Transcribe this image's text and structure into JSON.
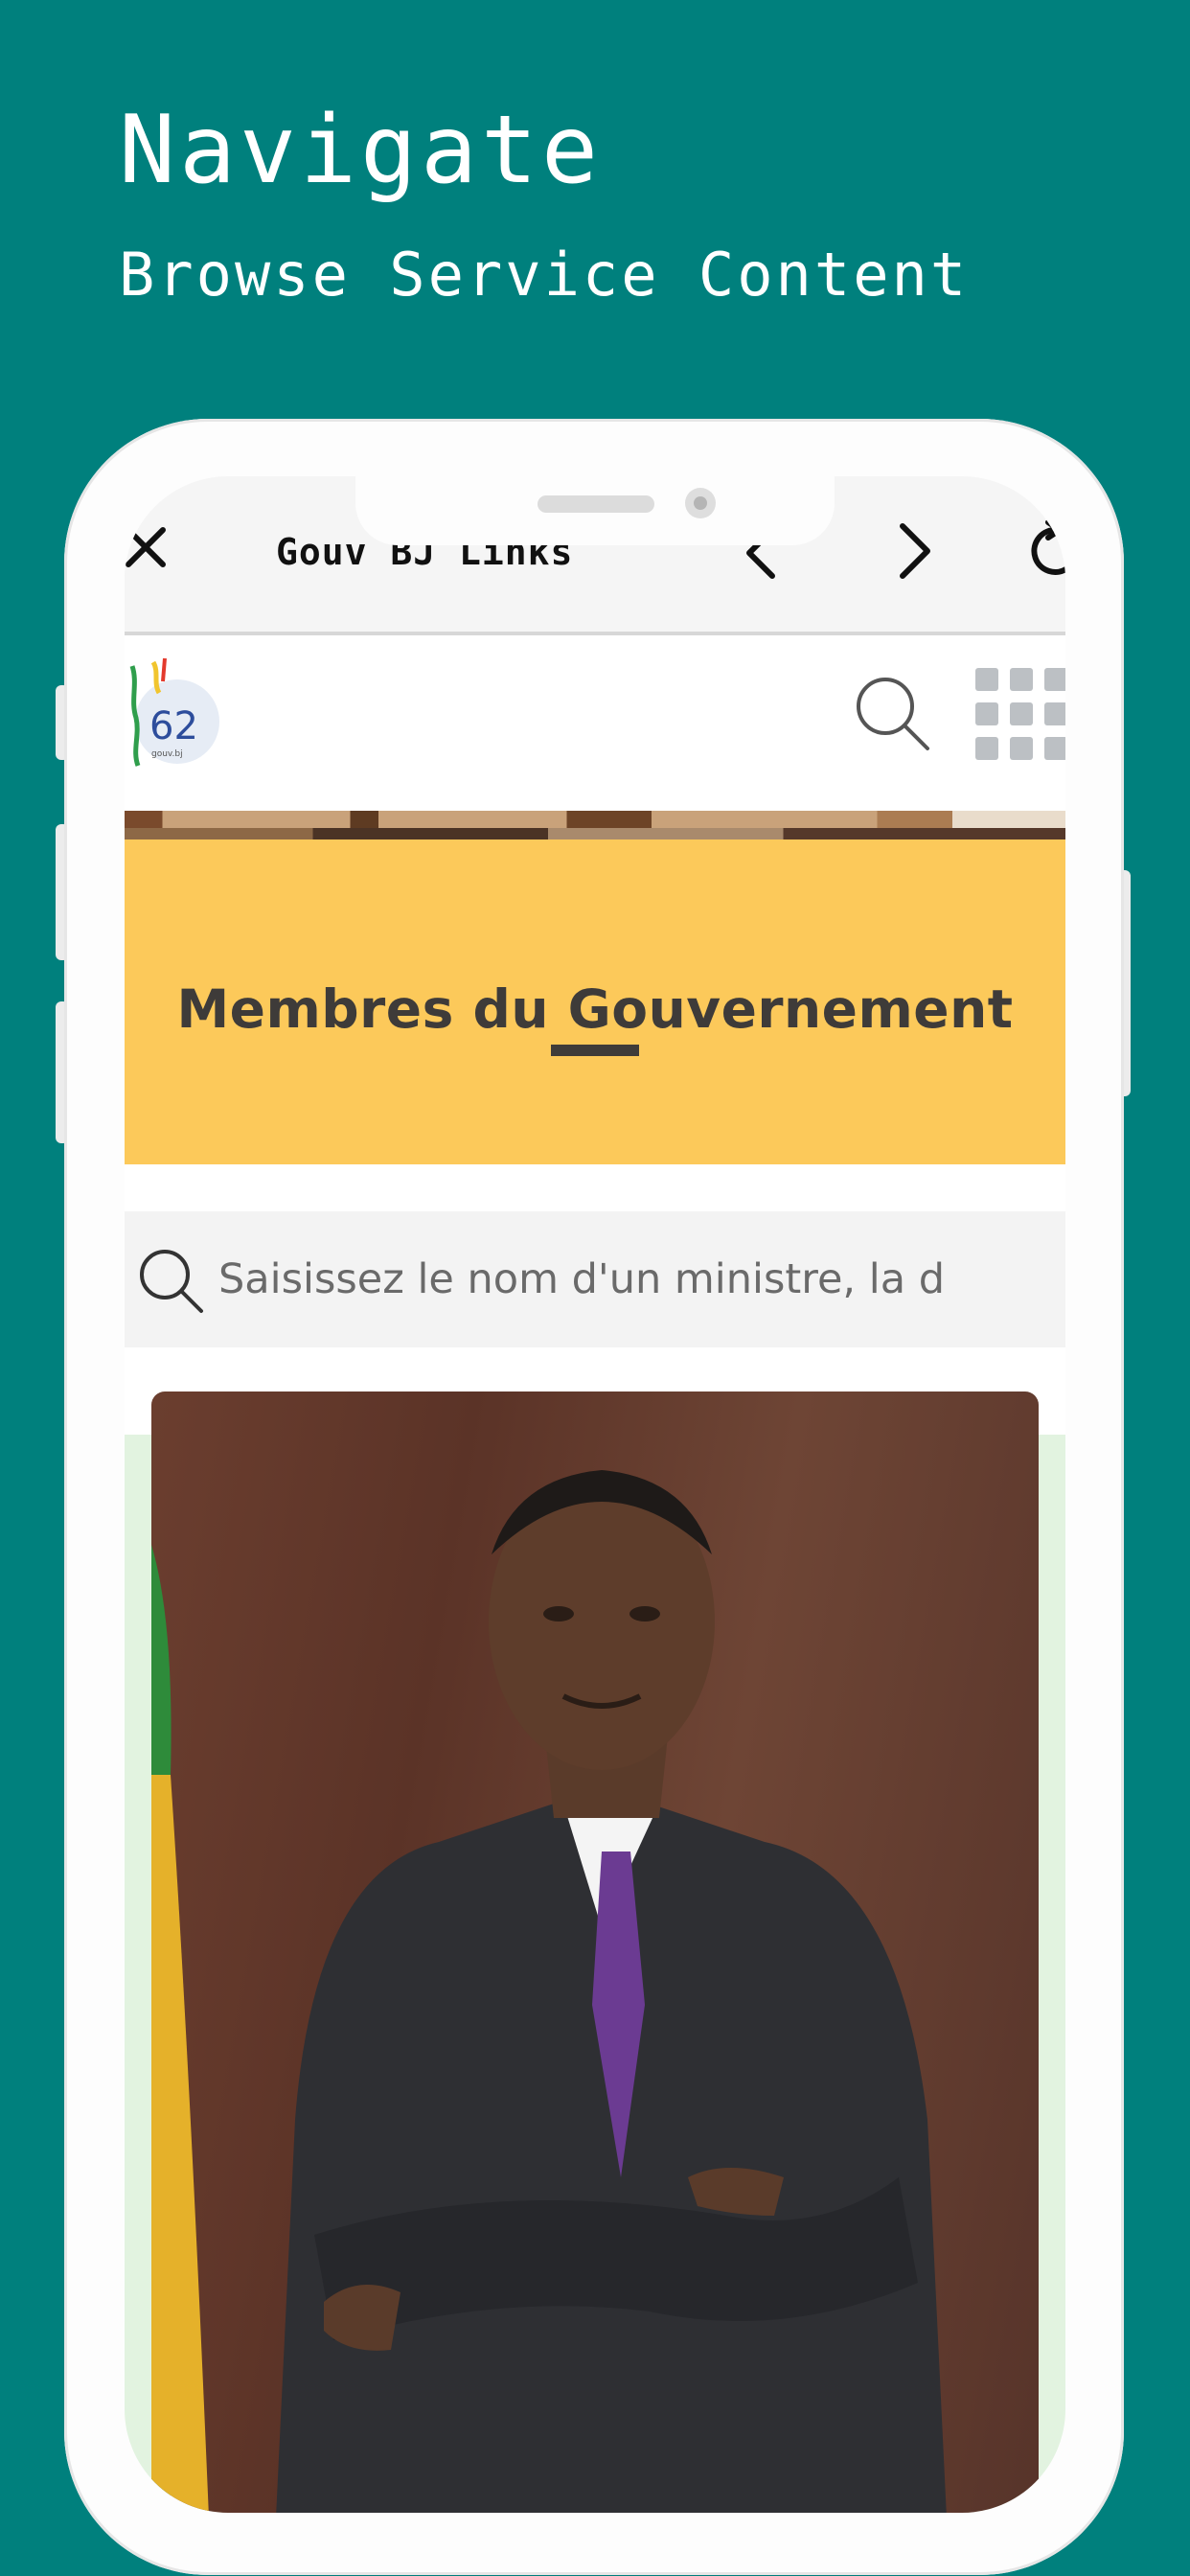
{
  "promo": {
    "headline": "Navigate",
    "subline": "Browse Service Content"
  },
  "browser_toolbar": {
    "title": "Gouv BJ Links",
    "close_icon": "close-icon",
    "back_icon": "chevron-left-icon",
    "forward_icon": "chevron-right-icon",
    "reload_icon": "reload-icon"
  },
  "site_header": {
    "logo_text": "62",
    "logo_caption": "gouv.bj",
    "search_icon": "search-icon",
    "menu_icon": "grid-menu-icon"
  },
  "banner": {
    "title": "Membres du Gouvernement"
  },
  "search": {
    "placeholder": "Saisissez le nom d'un ministre, la d"
  },
  "portrait": {
    "icon": "portrait-photo"
  },
  "colors": {
    "background": "#00807d",
    "banner": "#fcc95a",
    "banner_text": "#3e3b39",
    "content_bg": "#e2f3e0"
  }
}
